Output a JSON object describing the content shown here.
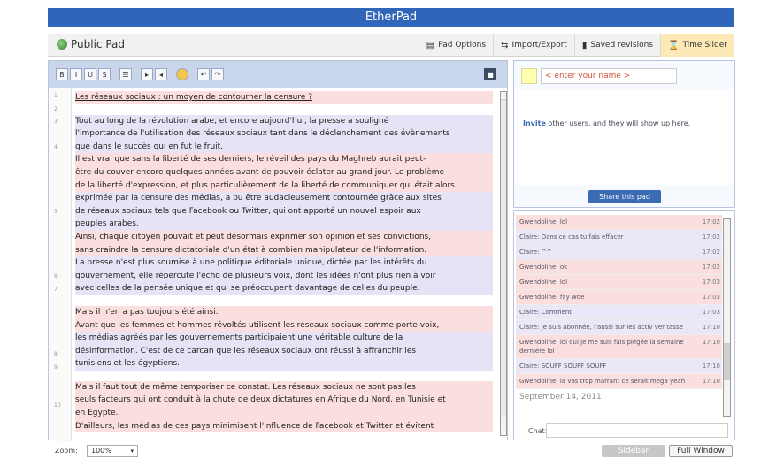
{
  "window_title": "EtherPad",
  "pad_title": "Public Pad",
  "top_actions": [
    {
      "label": "Pad Options",
      "icon": "document-icon"
    },
    {
      "label": "Import/Export",
      "icon": "import-export-icon"
    },
    {
      "label": "Saved revisions",
      "icon": "bookmark-icon"
    },
    {
      "label": "Time Slider",
      "icon": "time-slider-icon"
    }
  ],
  "toolbar": {
    "bold": "B",
    "italic": "I",
    "underline": "U",
    "strike": "S",
    "bullets": "☰",
    "indent": "▸",
    "outdent": "◂",
    "undo": "↶",
    "redo": "↷",
    "saved": "■"
  },
  "doc": {
    "title": "Les réseaux sociaux : un moyen de contourner la censure ?",
    "lines": [
      "    Tout au long de la révolution arabe, et encore aujourd'hui, la presse a souligné",
      "l'importance de l'utilisation des réseaux sociaux tant dans le déclenchement des évènements",
      "que dans le succès qui en fut le fruit.",
      "Il est vrai que sans la liberté de ses derniers, le réveil des pays du Maghreb aurait peut-",
      "être du couver encore quelques années avant de pouvoir éclater au grand jour. Le problème",
      "de la liberté d'expression, et plus particulièrement de la liberté de communiquer qui était alors",
      "exprimée par la censure des médias, a pu être audacieusement contournée grâce aux sites",
      "de réseaux sociaux tels que Facebook ou Twitter, qui ont apporté un nouvel espoir aux",
      "peuples arabes.",
      "Ainsi, chaque citoyen pouvait et peut désormais exprimer son opinion et ses convictions,",
      "sans craindre la censure dictatoriale d'un état à combien  manipulateur de l'information.",
      "La presse n'est plus soumise à une politique éditoriale unique, dictée par les intérêts du",
      "gouvernement, elle répercute l'écho de plusieurs voix, dont les idées n'ont plus rien à voir",
      "avec celles de la pensée unique et qui se préoccupent davantage de celles du peuple.",
      "",
      "    Mais il n'en a pas toujours été ainsi.",
      "Avant que les femmes et hommes révoltés utilisent les réseaux sociaux comme porte-voix,",
      "les médias agréés par les gouvernements participaient une véritable culture de la",
      "désinformation. C'est de ce carcan que les réseaux sociaux ont réussi à affranchir les",
      "tunisiens et les égyptiens.",
      "",
      "    Mais il faut tout de même temporiser ce constat. Les réseaux sociaux ne sont pas les",
      "seuls facteurs qui ont conduit à la chute de deux dictatures  en Afrique du Nord, en Tunisie et",
      "en Egypte.",
      "D'ailleurs, les médias de ces pays minimisent l'influence de Facebook et Twitter et évitent"
    ]
  },
  "users": {
    "name_placeholder": "< enter your name >",
    "invite_link": "Invite",
    "invite_rest": " other users, and they will show up here.",
    "share_button": "Share this pad"
  },
  "chat": {
    "messages": [
      {
        "author": "Gwendoline",
        "text": "lol",
        "time": "17:02",
        "style": "g"
      },
      {
        "author": "Claire",
        "text": "Dans ce cas tu fais effacer",
        "time": "17:02",
        "style": "c"
      },
      {
        "author": "Claire",
        "text": "^^",
        "time": "17:02",
        "style": "c"
      },
      {
        "author": "Gwendoline",
        "text": "ok",
        "time": "17:02",
        "style": "g"
      },
      {
        "author": "Gwendoline",
        "text": "lol",
        "time": "17:03",
        "style": "g"
      },
      {
        "author": "Gwendoline",
        "text": "fay wde",
        "time": "17:03",
        "style": "g"
      },
      {
        "author": "Claire",
        "text": "Comment",
        "time": "17:03",
        "style": "c"
      },
      {
        "author": "Claire",
        "text": "Je suis abonnée, l'aussi sur les activ ver tasse",
        "time": "17:10",
        "style": "c"
      },
      {
        "author": "Gwendoline",
        "text": "lol oui je me suis fais piégée la semaine dernière lol",
        "time": "17:10",
        "style": "g"
      },
      {
        "author": "Claire",
        "text": "SOUFF SOUFF SOUFF",
        "time": "17:10",
        "style": "c"
      },
      {
        "author": "Gwendoline",
        "text": "la vas trop marrant ce serait mega yeah",
        "time": "17:10",
        "style": "g"
      }
    ],
    "date": "September 14, 2011",
    "label": "Chat:"
  },
  "bottom": {
    "zoom_label": "Zoom:",
    "zoom_value": "100%",
    "sidebar_button": "Sidebar",
    "fullwindow_button": "Full Window"
  }
}
